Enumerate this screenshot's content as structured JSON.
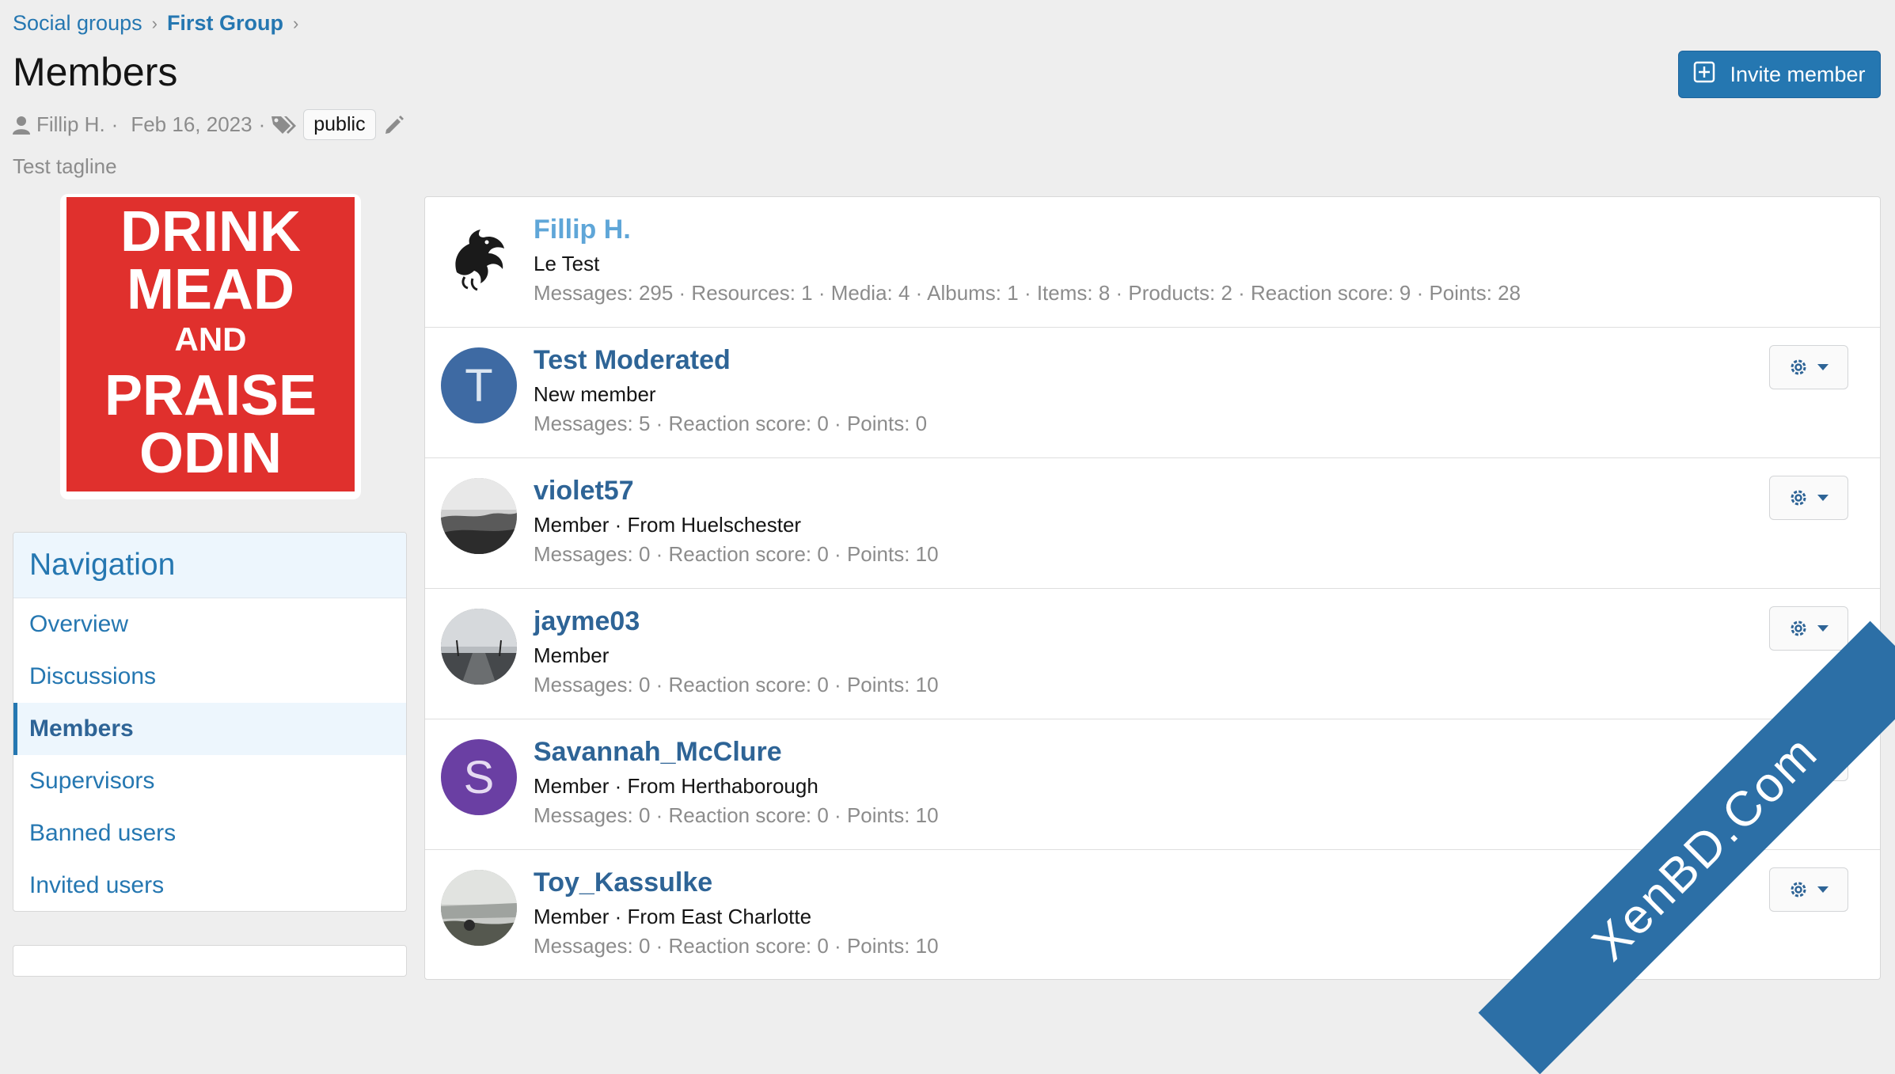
{
  "breadcrumb": [
    {
      "label": "Social groups"
    },
    {
      "label": "First Group"
    }
  ],
  "page": {
    "title": "Members",
    "tagline": "Test tagline",
    "invite_label": "Invite member"
  },
  "meta": {
    "author": "Fillip H.",
    "date": "Feb 16, 2023",
    "tag": "public",
    "sep": "·"
  },
  "group_avatar": {
    "lines": [
      "DRINK",
      "MEAD",
      "AND",
      "PRAISE",
      "ODIN"
    ],
    "background": "#e0302d"
  },
  "navigation": {
    "title": "Navigation",
    "items": [
      {
        "label": "Overview"
      },
      {
        "label": "Discussions"
      },
      {
        "label": "Members",
        "active": true
      },
      {
        "label": "Supervisors"
      },
      {
        "label": "Banned users"
      },
      {
        "label": "Invited users"
      }
    ]
  },
  "members": [
    {
      "name": "Fillip H.",
      "title": "Le Test",
      "stats": "Messages: 295 · Resources: 1 · Media: 4 · Albums: 1 · Items: 8 · Products: 2 · Reaction score: 9 · Points: 28",
      "avatar": "dragon-icon"
    },
    {
      "name": "Test Moderated",
      "title": "New member",
      "stats": "Messages: 5 · Reaction score: 0 · Points: 0",
      "avatar_letter": "T",
      "avatar_color": "#3e6aa3"
    },
    {
      "name": "violet57",
      "title": "Member · From Huelschester",
      "stats": "Messages: 0 · Reaction score: 0 · Points: 10",
      "avatar": "photo"
    },
    {
      "name": "jayme03",
      "title": "Member",
      "stats": "Messages: 0 · Reaction score: 0 · Points: 10",
      "avatar": "photo"
    },
    {
      "name": "Savannah_McClure",
      "title": "Member · From Herthaborough",
      "stats": "Messages: 0 · Reaction score: 0 · Points: 10",
      "avatar_letter": "S",
      "avatar_color": "#6a3fa3"
    },
    {
      "name": "Toy_Kassulke",
      "title": "Member · From East Charlotte",
      "stats": "Messages: 0 · Reaction score: 0 · Points: 10",
      "avatar": "photo"
    }
  ],
  "watermark": "XenBD.Com",
  "colors": {
    "link": "#2577b1",
    "accent": "#2c6fa6",
    "muted": "#8c8c8c"
  }
}
